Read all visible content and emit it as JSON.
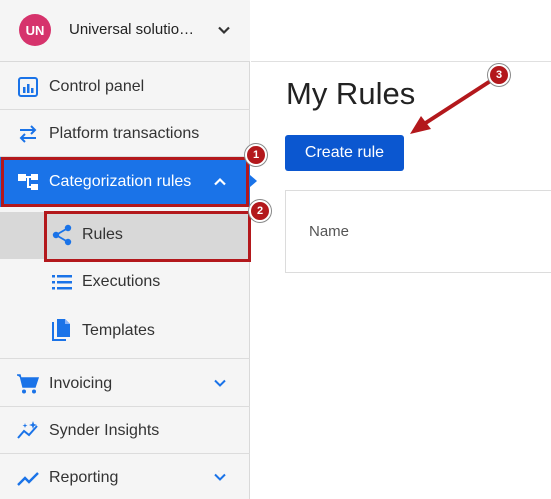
{
  "org": {
    "initials": "UN",
    "name": "Universal solutio…"
  },
  "sidebar": {
    "items": [
      {
        "label": "Control panel"
      },
      {
        "label": "Platform transactions"
      },
      {
        "label": "Categorization rules"
      },
      {
        "label": "Invoicing"
      },
      {
        "label": "Synder Insights"
      },
      {
        "label": "Reporting"
      }
    ],
    "subitems": [
      {
        "label": "Rules"
      },
      {
        "label": "Executions"
      },
      {
        "label": "Templates"
      }
    ]
  },
  "main": {
    "title": "My Rules",
    "create_button": "Create rule",
    "table": {
      "columns": [
        "Name"
      ]
    }
  },
  "annotations": {
    "badge1": "1",
    "badge2": "2",
    "badge3": "3"
  },
  "colors": {
    "accent": "#1a73e8",
    "button": "#0b57d0",
    "annotation": "#b3181c",
    "avatar": "#d6336c"
  }
}
